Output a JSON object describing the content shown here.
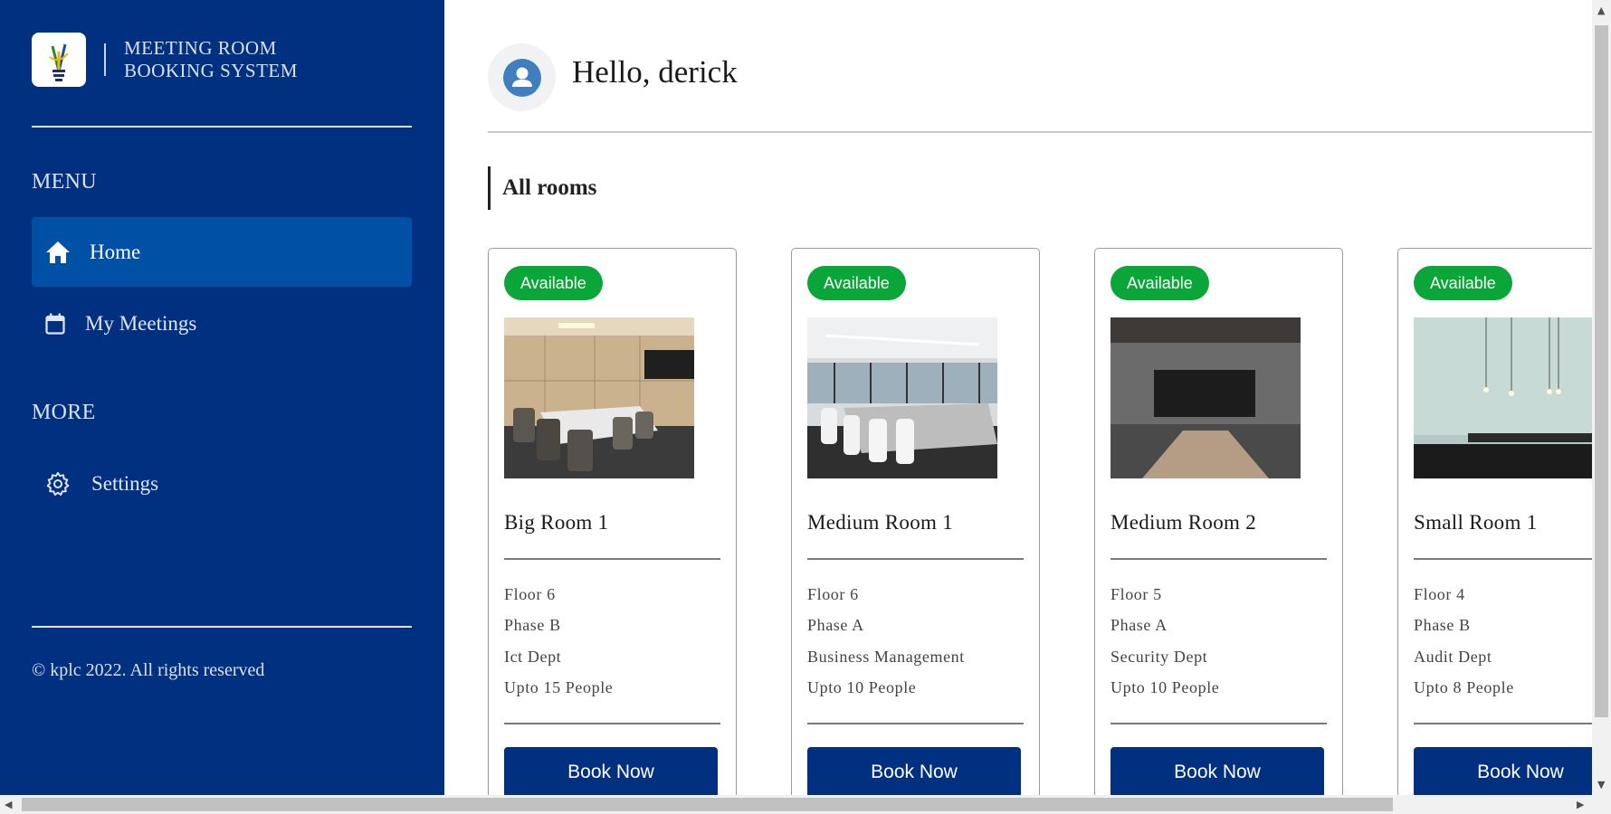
{
  "brand": {
    "line1": "MEETING ROOM",
    "line2": "BOOKING SYSTEM",
    "logo_icon": "kplc-logo-icon"
  },
  "sidebar": {
    "menu_label": "MENU",
    "more_label": "MORE",
    "items": [
      {
        "label": "Home",
        "icon": "home-icon",
        "active": true
      },
      {
        "label": "My Meetings",
        "icon": "calendar-icon",
        "active": false
      }
    ],
    "more_items": [
      {
        "label": "Settings",
        "icon": "gear-icon"
      }
    ],
    "copyright": "© kplc 2022. All rights reserved"
  },
  "header": {
    "greeting": "Hello, derick"
  },
  "main": {
    "section_title": "All rooms"
  },
  "rooms": [
    {
      "status": "Available",
      "name": "Big Room 1",
      "floor": "Floor 6",
      "phase": "Phase B",
      "dept": "Ict Dept",
      "capacity": "Upto 15 People",
      "button": "Book Now"
    },
    {
      "status": "Available",
      "name": "Medium Room 1",
      "floor": "Floor 6",
      "phase": "Phase A",
      "dept": "Business Management",
      "capacity": "Upto 10 People",
      "button": "Book Now"
    },
    {
      "status": "Available",
      "name": "Medium Room 2",
      "floor": "Floor 5",
      "phase": "Phase A",
      "dept": "Security Dept",
      "capacity": "Upto 10 People",
      "button": "Book Now"
    },
    {
      "status": "Available",
      "name": "Small Room 1",
      "floor": "Floor 4",
      "phase": "Phase B",
      "dept": "Audit Dept",
      "capacity": "Upto 8 People",
      "button": "Book Now"
    }
  ],
  "colors": {
    "sidebar_bg": "#00307f",
    "active_item": "#0050a6",
    "available_badge": "#0aa63a",
    "button_bg": "#00307f"
  }
}
